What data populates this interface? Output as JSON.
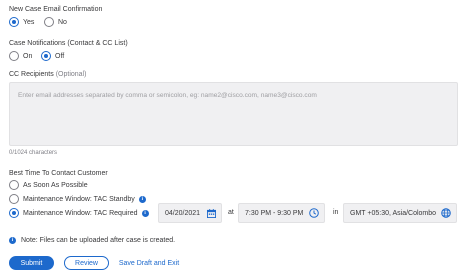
{
  "email_confirmation": {
    "label": "New Case Email Confirmation",
    "options": [
      "Yes",
      "No"
    ],
    "selected": "Yes"
  },
  "case_notifications": {
    "label": "Case Notifications (Contact & CC List)",
    "options": [
      "On",
      "Off"
    ],
    "selected": "Off"
  },
  "cc_recipients": {
    "label": "CC Recipients",
    "optional": "(Optional)",
    "placeholder": "Enter email addresses separated by comma or semicolon, eg: name2@cisco.com, name3@cisco.com",
    "counter": "0/1024 characters"
  },
  "best_time": {
    "label": "Best Time To Contact Customer",
    "options": [
      "As Soon As Possible",
      "Maintenance Window: TAC Standby",
      "Maintenance Window: TAC Required"
    ],
    "selected": "Maintenance Window: TAC Required",
    "date": "04/20/2021",
    "at_label": "at",
    "time_range": "7:30 PM - 9:30 PM",
    "in_label": "in",
    "timezone": "GMT +05:30, Asia/Colombo"
  },
  "note": "Note: Files can be uploaded after case is created.",
  "buttons": {
    "submit": "Submit",
    "review": "Review",
    "save_draft": "Save Draft and Exit"
  },
  "colors": {
    "accent": "#1d69cc",
    "field_bg": "#f0f0f2",
    "text": "#39393b",
    "muted": "#9e9ea2"
  },
  "icons": {
    "info": "info-icon",
    "calendar": "calendar-icon",
    "clock": "clock-icon",
    "globe": "globe-icon"
  }
}
